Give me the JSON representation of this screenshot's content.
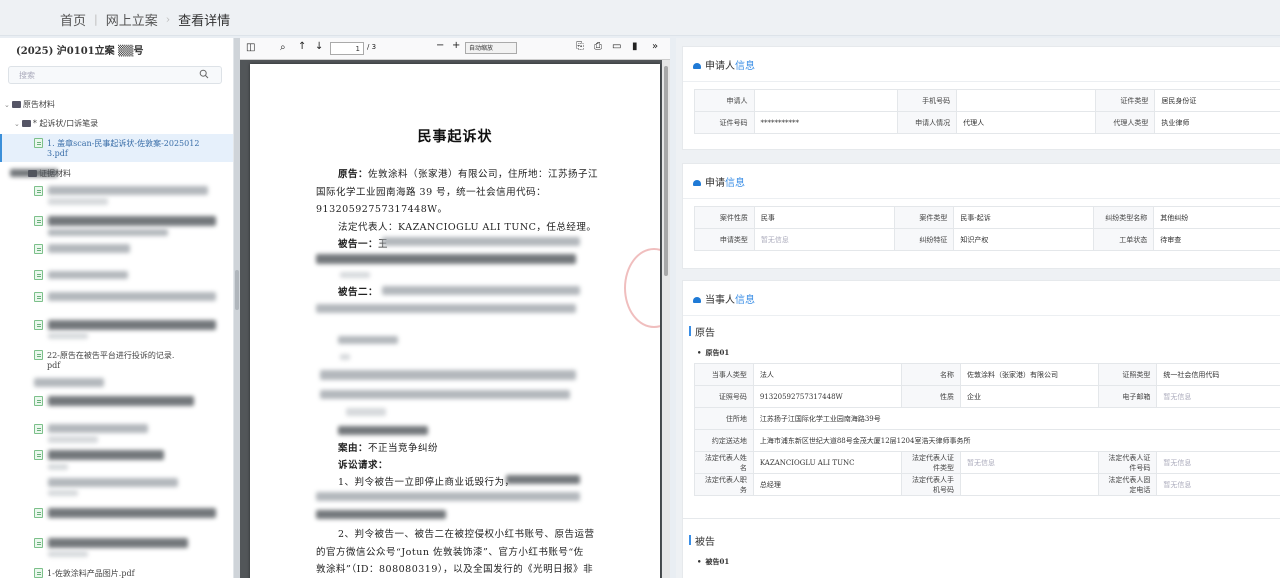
{
  "breadcrumb": {
    "home": "首页",
    "online_filing": "网上立案",
    "current": "查看详情"
  },
  "left_panel": {
    "case_number": "(2025) 沪0101立案 ▒▒号",
    "search_placeholder": "搜索",
    "tree": [
      {
        "label": "原告材料",
        "type": "folder"
      },
      {
        "label": "* 起诉状/口诉笔录",
        "type": "folder"
      },
      {
        "label": "1. 盖章scan-民事起诉状-佐敦案-2025012",
        "label2": "3.pdf",
        "type": "file",
        "selected": true
      },
      {
        "label": "证据材料",
        "type": "folder"
      },
      {
        "label": "22-原告在被告平台进行投诉的记录.",
        "label2": "pdf",
        "type": "file"
      },
      {
        "label": "1-佐敦涂料产品图片.pdf",
        "type": "file"
      }
    ]
  },
  "pdf_viewer": {
    "page_current": "1",
    "page_total": "/ 3",
    "zoom": "自动缩放",
    "doc_title": "民事起诉状",
    "lines": [
      {
        "label": "原告：",
        "text": "佐敦涂料（张家港）有限公司，住所地：江苏扬子江"
      },
      {
        "text": "国际化学工业园南海路 39 号，统一社会信用代码："
      },
      {
        "text": "91320592757317448W。"
      },
      {
        "text": "法定代表人：KAZANCIOGLU ALI TUNC，任总经理。"
      },
      {
        "label": "被告一：",
        "text": "王"
      },
      {
        "label": "被告二：",
        "text": ""
      },
      {
        "label": "案由：",
        "text": "不正当竞争纠纷"
      },
      {
        "label": "诉讼请求：",
        "text": ""
      },
      {
        "text": "1、判令被告一立即停止商业诋毁行为，"
      },
      {
        "text": "2、判令被告一、被告二在被控侵权小红书账号、原告运营"
      },
      {
        "text": "的官方微信公众号“Jotun 佐敦装饰漆”、官方小红书账号“佐"
      },
      {
        "text": "敦涂料”（ID：808080319），以及全国发行的《光明日报》非"
      }
    ]
  },
  "applicant_info": {
    "header_plain": "申请人",
    "header_hl": "信息",
    "rows": [
      [
        {
          "k": "申请人",
          "v": ""
        },
        {
          "k": "手机号码",
          "v": ""
        },
        {
          "k": "证件类型",
          "v": "居民身份证"
        }
      ],
      [
        {
          "k": "证件号码",
          "v": "***********"
        },
        {
          "k": "申请人情况",
          "v": "代理人"
        },
        {
          "k": "代理人类型",
          "v": "执业律师"
        }
      ]
    ]
  },
  "application_info": {
    "header_plain": "申请",
    "header_hl": "信息",
    "rows": [
      [
        {
          "k": "案件性质",
          "v": "民事"
        },
        {
          "k": "案件类型",
          "v": "民事-起诉"
        },
        {
          "k": "纠纷类型名称",
          "v": "其他纠纷"
        }
      ],
      [
        {
          "k": "申请类型",
          "v": "暂无信息",
          "muted": true
        },
        {
          "k": "纠纷特征",
          "v": "知识产权"
        },
        {
          "k": "工单状态",
          "v": "待审查"
        }
      ]
    ]
  },
  "party_info": {
    "header_plain": "当事人",
    "header_hl": "信息",
    "plaintiff_label": "原告",
    "plaintiff_index": "原告01",
    "plaintiff_rows": {
      "party_type_k": "当事人类型",
      "party_type_v": "法人",
      "name_k": "名称",
      "name_v": "佐敦涂料（张家港）有限公司",
      "id_type_k": "证照类型",
      "id_type_v": "统一社会信用代码",
      "id_no_k": "证照号码",
      "id_no_v": "91320592757317448W",
      "nature_k": "性质",
      "nature_v": "企业",
      "email_k": "电子邮箱",
      "email_v": "暂无信息",
      "address_k": "住所地",
      "address_v": "江苏扬子江国际化学工业园南海路39号",
      "service_k": "约定送达地",
      "service_v": "上海市浦东新区世纪大道88号金茂大厦12层1204室浩天律师事务所",
      "legal_name_k": "法定代表人姓名",
      "legal_name_v": "KAZANCIOGLU ALI TUNC",
      "legal_id_type_k": "法定代表人证件类型",
      "legal_id_type_v": "暂无信息",
      "legal_id_no_k": "法定代表人证件号码",
      "legal_id_no_v": "暂无信息",
      "legal_title_k": "法定代表人职务",
      "legal_title_v": "总经理",
      "legal_phone_k": "法定代表人手机号码",
      "legal_phone_v": "",
      "legal_tel_k": "法定代表人固定电话",
      "legal_tel_v": "暂无信息"
    },
    "defendant_label": "被告",
    "defendant_index": "被告01"
  }
}
